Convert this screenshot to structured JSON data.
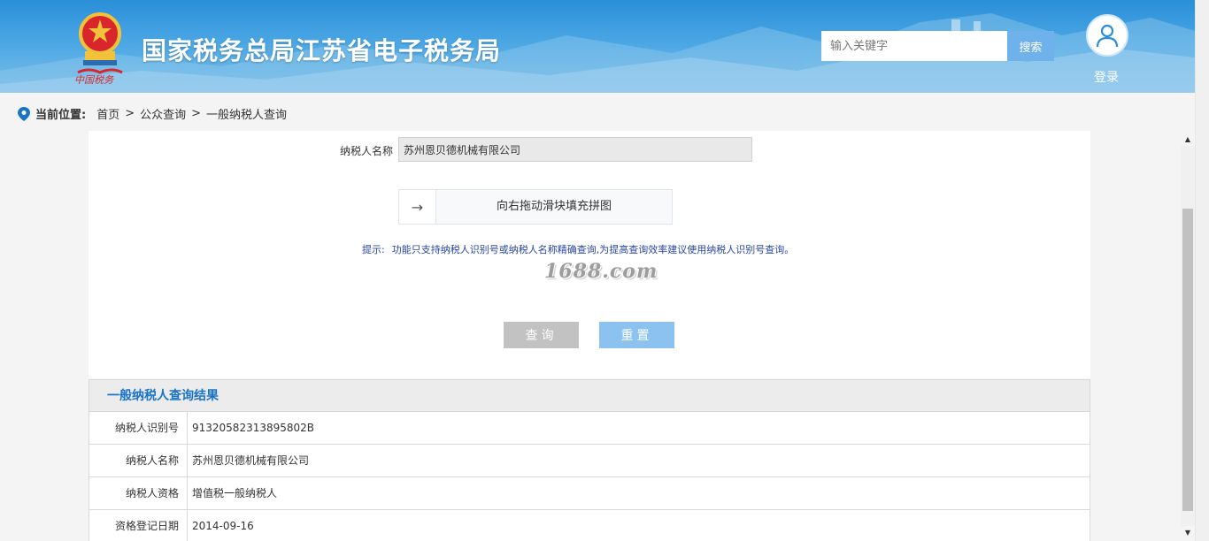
{
  "header": {
    "site_title": "国家税务总局江苏省电子税务局",
    "search_placeholder": "输入关键字",
    "search_button": "搜索",
    "login_label": "登录"
  },
  "breadcrumb": {
    "label": "当前位置:",
    "items": [
      "首页",
      "公众查询",
      "一般纳税人查询"
    ],
    "separator": ">"
  },
  "form": {
    "taxpayer_name_label": "纳税人名称",
    "taxpayer_name_value": "苏州恩贝德机械有限公司",
    "slider_text": "向右拖动滑块填充拼图",
    "slider_icon": "arrow-right-icon",
    "hint_label": "提示:",
    "hint_text": "功能只支持纳税人识别号或纳税人名称精确查询,为提高查询效率建议使用纳税人识别号查询。",
    "watermark": "1688.com",
    "query_button": "查询",
    "reset_button": "重置"
  },
  "results": {
    "title": "一般纳税人查询结果",
    "rows": [
      {
        "key": "纳税人识别号",
        "value": "91320582313895802B"
      },
      {
        "key": "纳税人名称",
        "value": "苏州恩贝德机械有限公司"
      },
      {
        "key": "纳税人资格",
        "value": "增值税一般纳税人"
      },
      {
        "key": "资格登记日期",
        "value": "2014-09-16"
      }
    ]
  },
  "colors": {
    "header_blue": "#2a8fd8",
    "results_title": "#1a73c7",
    "hint_text": "#2845a8",
    "reset_button": "#8cc2f0",
    "query_button": "#c2c2c2"
  }
}
